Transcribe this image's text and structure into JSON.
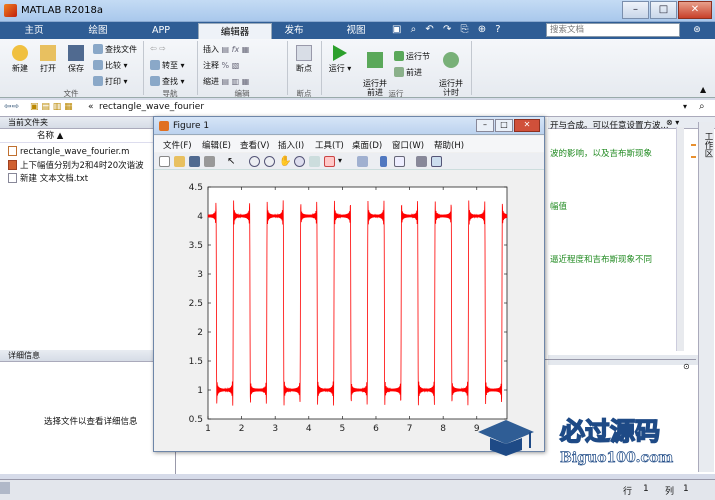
{
  "window": {
    "title": "MATLAB R2018a"
  },
  "tabs": [
    "主页",
    "绘图",
    "APP",
    "编辑器",
    "发布",
    "视图"
  ],
  "search": {
    "placeholder": "搜索文档"
  },
  "ribbon": {
    "file": {
      "new": "新建",
      "open": "打开",
      "save": "保存",
      "find_files": "查找文件",
      "compare": "比较",
      "print": "打印",
      "label": "文件"
    },
    "nav": {
      "goto": "转至",
      "find": "查找",
      "label": "导航"
    },
    "edit": {
      "insert": "插入",
      "comment": "注释",
      "indent": "缩进",
      "label": "编辑"
    },
    "breakpoints": {
      "label": "断点",
      "btn": "断点"
    },
    "run": {
      "run": "运行",
      "run_advance": "运行并\n前进",
      "run_section": "运行节",
      "advance": "前进",
      "run_time": "运行并\n计时",
      "label": "运行"
    }
  },
  "address": {
    "folder": "rectangle_wave_fourier"
  },
  "current_folder": {
    "header": "当前文件夹",
    "col_name": "名称 ▲",
    "files": [
      "rectangle_wave_fourier.m",
      "上下幅值分别为2和4时20次谐波",
      "新建 文本文档.txt"
    ]
  },
  "details": {
    "header": "详细信息",
    "empty_msg": "选择文件以查看详细信息"
  },
  "editor_snippets": [
    "开与合成。可以任意设置方波...",
    "波的影响，以及吉布斯现象",
    "幅值",
    "逼近程度和吉布斯现象不同"
  ],
  "side_tab": "工作区",
  "status": {
    "line_label": "行",
    "line_value": "1",
    "col_label": "列",
    "col_value": "1"
  },
  "figure": {
    "title": "Figure 1",
    "menus": [
      "文件(F)",
      "编辑(E)",
      "查看(V)",
      "插入(I)",
      "工具(T)",
      "桌面(D)",
      "窗口(W)",
      "帮助(H)"
    ]
  },
  "chart_data": {
    "type": "line",
    "title": "",
    "xlabel": "",
    "ylabel": "",
    "xlim": [
      1,
      9.9
    ],
    "ylim": [
      0.5,
      4.5
    ],
    "xticks": [
      1,
      2,
      3,
      4,
      5,
      6,
      7,
      8,
      9
    ],
    "yticks": [
      0.5,
      1,
      1.5,
      2,
      2.5,
      3,
      3.5,
      4,
      4.5
    ],
    "series": [
      {
        "color": "#ff0000",
        "waveform": "square wave, 20-harmonic Fourier approximation",
        "low": 1,
        "high": 4,
        "period": 1,
        "harmonics": 20
      }
    ],
    "grid": false
  },
  "watermark": {
    "main": "必过源码",
    "sub": "Biguo100.com"
  },
  "colors": {
    "accent": "#2f5d95",
    "plot_line": "#ff0000",
    "comment": "#228b22"
  }
}
